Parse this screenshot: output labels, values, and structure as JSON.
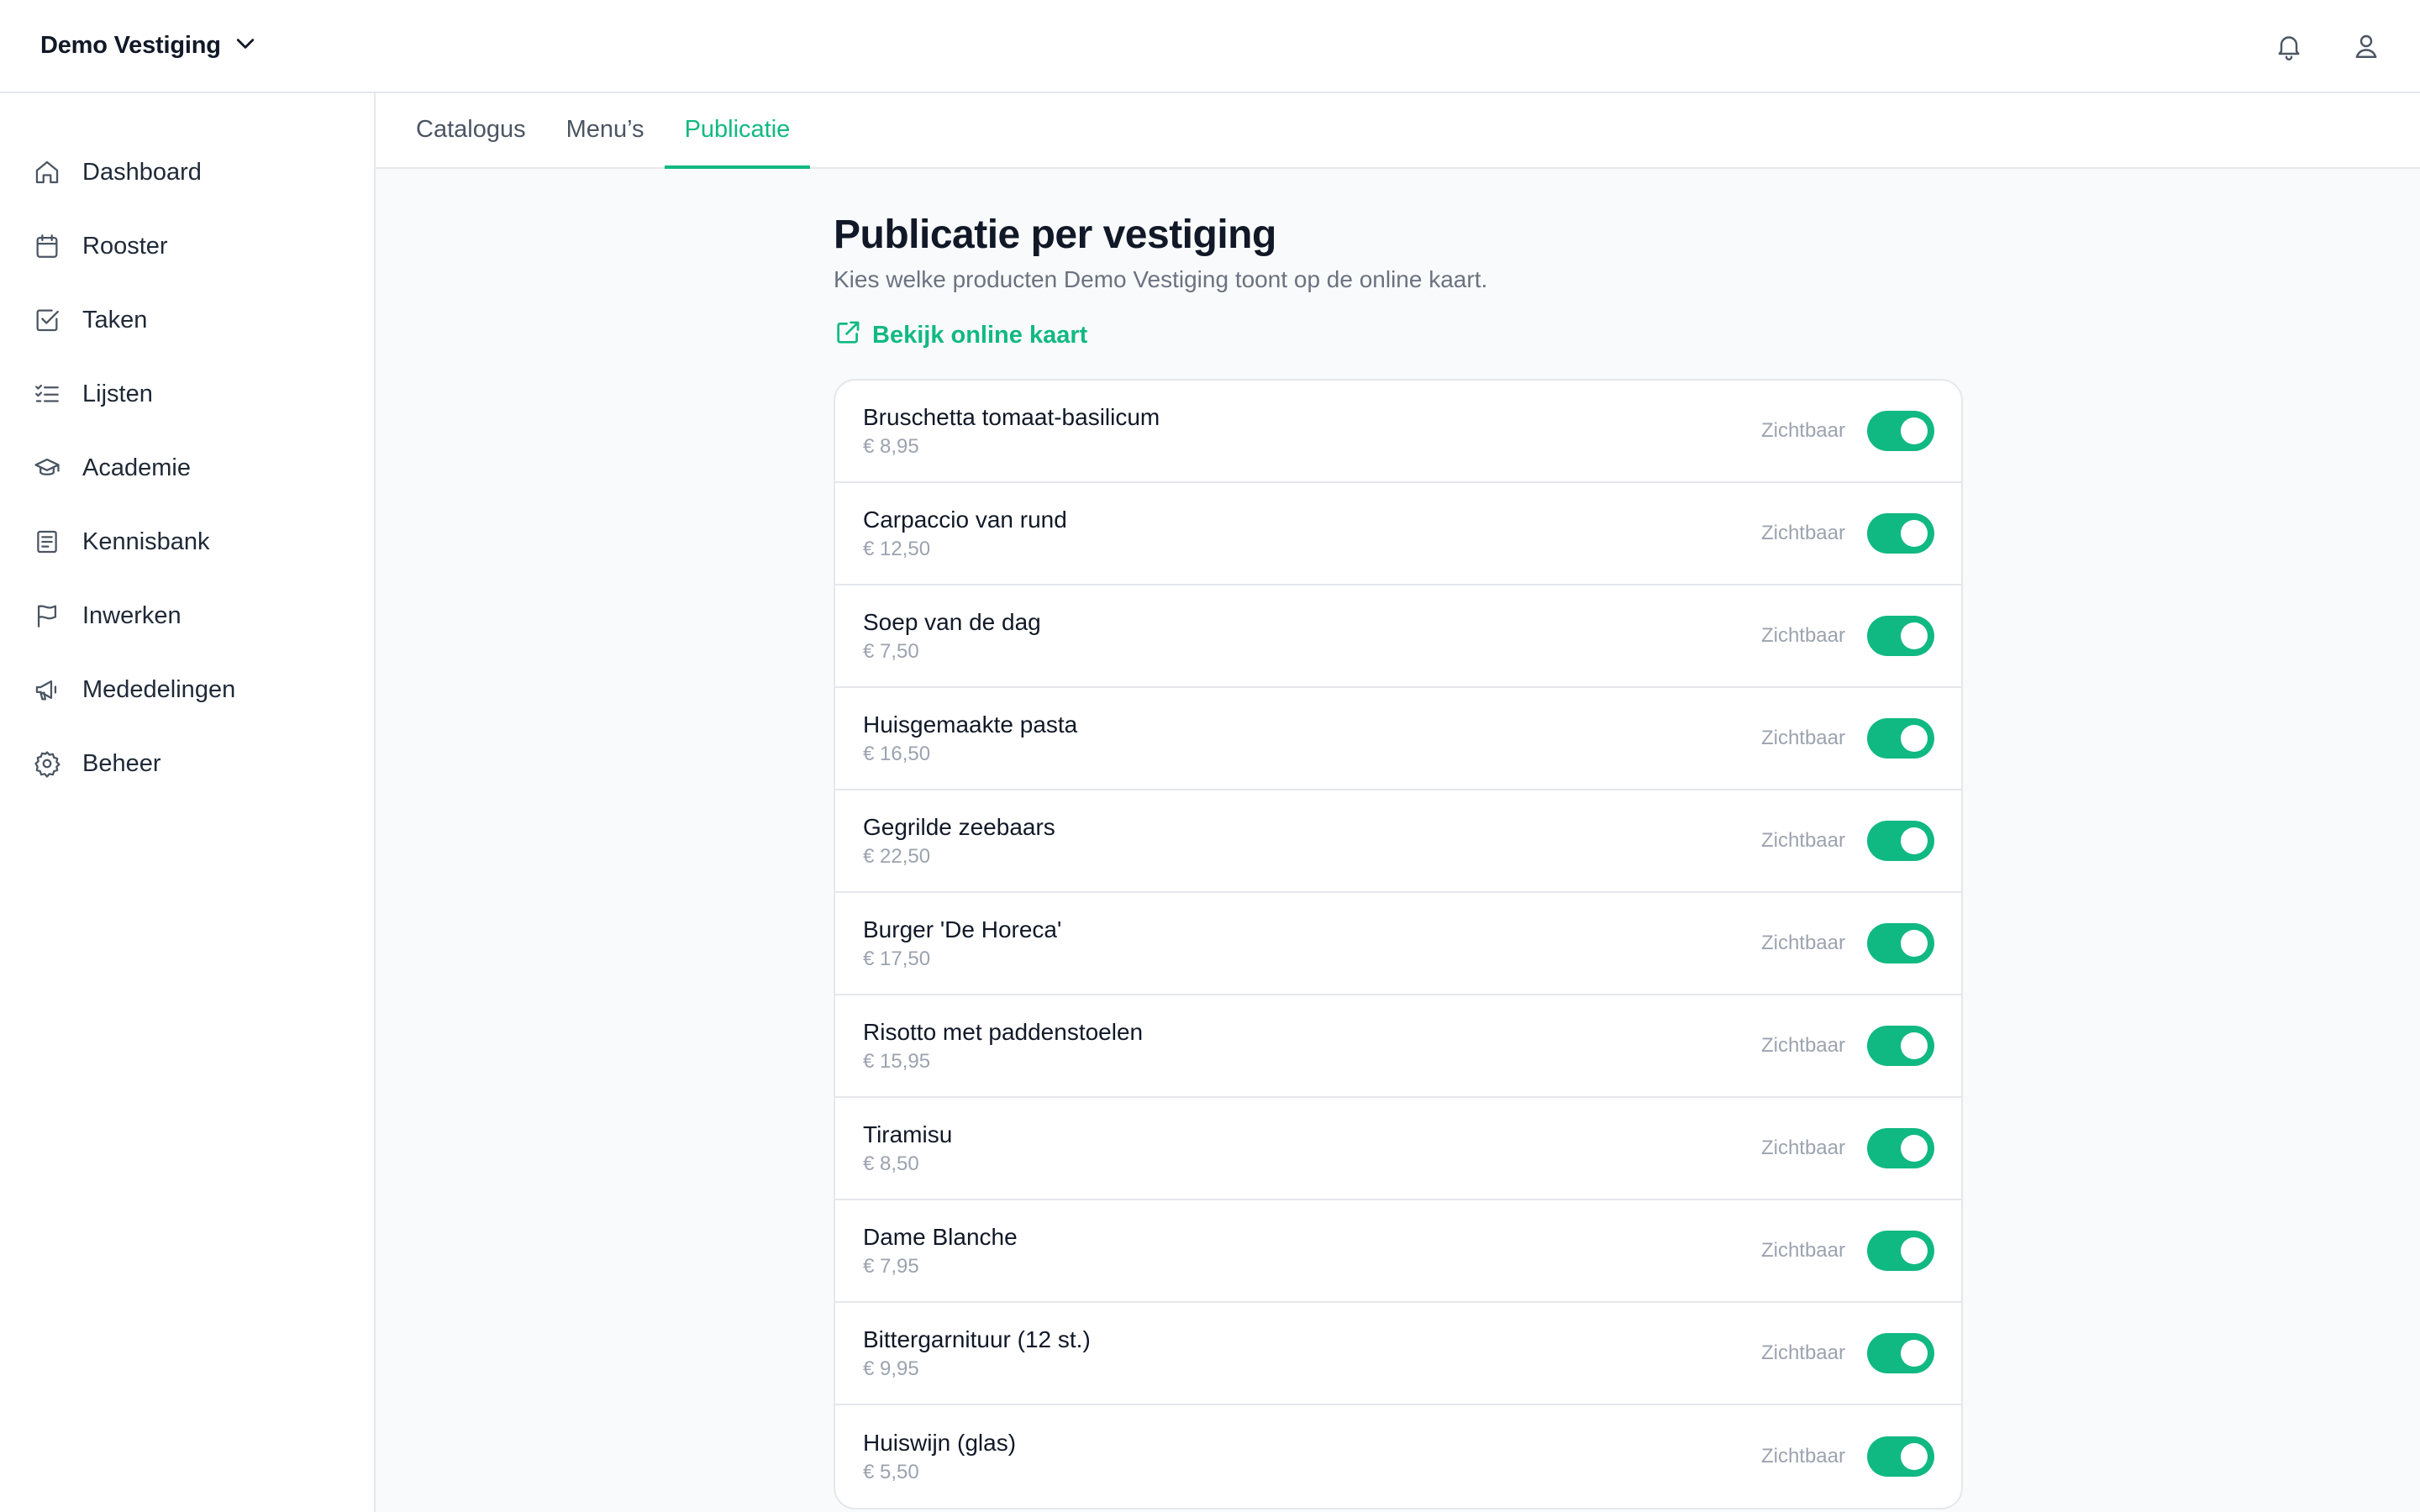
{
  "header": {
    "location_name": "Demo Vestiging"
  },
  "sidebar": {
    "items": [
      {
        "label": "Dashboard",
        "icon": "home-icon"
      },
      {
        "label": "Rooster",
        "icon": "calendar-icon"
      },
      {
        "label": "Taken",
        "icon": "checkbox-icon"
      },
      {
        "label": "Lijsten",
        "icon": "list-check-icon"
      },
      {
        "label": "Academie",
        "icon": "graduation-cap-icon"
      },
      {
        "label": "Kennisbank",
        "icon": "book-icon"
      },
      {
        "label": "Inwerken",
        "icon": "flag-icon"
      },
      {
        "label": "Mededelingen",
        "icon": "megaphone-icon"
      },
      {
        "label": "Beheer",
        "icon": "gear-icon"
      }
    ]
  },
  "tabs": [
    {
      "label": "Catalogus",
      "active": false
    },
    {
      "label": "Menu’s",
      "active": false
    },
    {
      "label": "Publicatie",
      "active": true
    }
  ],
  "page": {
    "title": "Publicatie per vestiging",
    "subtitle": "Kies welke producten Demo Vestiging toont op de online kaart.",
    "link_label": "Bekijk online kaart"
  },
  "products": [
    {
      "name": "Bruschetta tomaat-basilicum",
      "price": "€ 8,95",
      "status": "Zichtbaar",
      "visible": true
    },
    {
      "name": "Carpaccio van rund",
      "price": "€ 12,50",
      "status": "Zichtbaar",
      "visible": true
    },
    {
      "name": "Soep van de dag",
      "price": "€ 7,50",
      "status": "Zichtbaar",
      "visible": true
    },
    {
      "name": "Huisgemaakte pasta",
      "price": "€ 16,50",
      "status": "Zichtbaar",
      "visible": true
    },
    {
      "name": "Gegrilde zeebaars",
      "price": "€ 22,50",
      "status": "Zichtbaar",
      "visible": true
    },
    {
      "name": "Burger 'De Horeca'",
      "price": "€ 17,50",
      "status": "Zichtbaar",
      "visible": true
    },
    {
      "name": "Risotto met paddenstoelen",
      "price": "€ 15,95",
      "status": "Zichtbaar",
      "visible": true
    },
    {
      "name": "Tiramisu",
      "price": "€ 8,50",
      "status": "Zichtbaar",
      "visible": true
    },
    {
      "name": "Dame Blanche",
      "price": "€ 7,95",
      "status": "Zichtbaar",
      "visible": true
    },
    {
      "name": "Bittergarnituur (12 st.)",
      "price": "€ 9,95",
      "status": "Zichtbaar",
      "visible": true
    },
    {
      "name": "Huiswijn (glas)",
      "price": "€ 5,50",
      "status": "Zichtbaar",
      "visible": true
    }
  ],
  "colors": {
    "accent": "#10b981",
    "text_primary": "#111827",
    "text_muted": "#9ca3af",
    "border": "#e5e7eb",
    "main_background": "#f9fafb"
  }
}
